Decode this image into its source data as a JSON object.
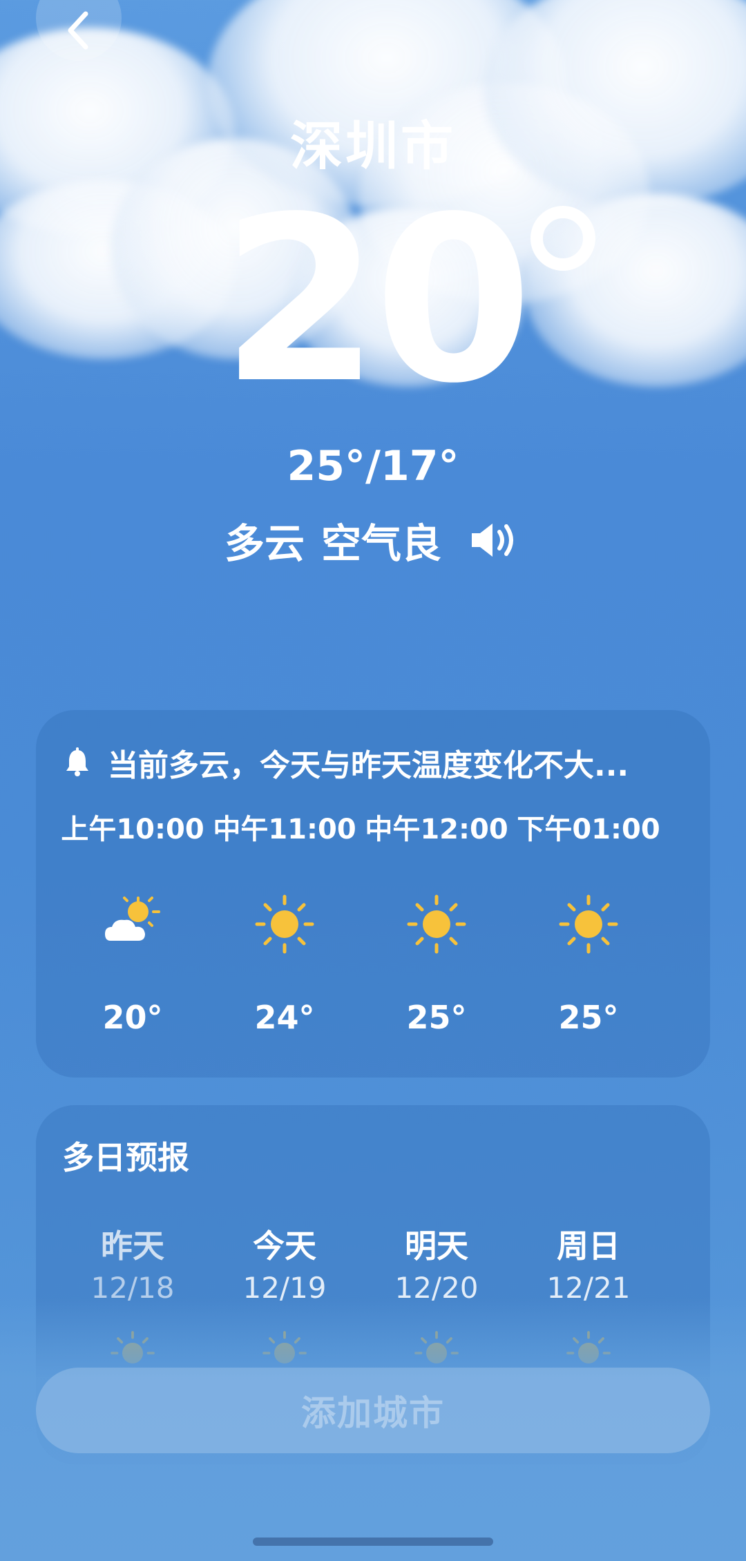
{
  "city": "深圳市",
  "current_temp": "20",
  "hi_lo": "25°/17°",
  "condition": "多云",
  "air_quality": "空气良",
  "alert": "当前多云，今天与昨天温度变化不大...",
  "hourly": [
    {
      "time": "上午10:00",
      "temp": "20°",
      "icon": "partly-cloudy-icon"
    },
    {
      "time": "中午11:00",
      "temp": "24°",
      "icon": "sunny-icon"
    },
    {
      "time": "中午12:00",
      "temp": "25°",
      "icon": "sunny-icon"
    },
    {
      "time": "下午01:00",
      "temp": "25°",
      "icon": "sunny-icon"
    }
  ],
  "daily_title": "多日预报",
  "daily": [
    {
      "day": "昨天",
      "date": "12/18",
      "icon": "sunny-icon"
    },
    {
      "day": "今天",
      "date": "12/19",
      "icon": "sunny-icon"
    },
    {
      "day": "明天",
      "date": "12/20",
      "icon": "sunny-icon"
    },
    {
      "day": "周日",
      "date": "12/21",
      "icon": "sunny-icon"
    }
  ],
  "add_city_label": "添加城市",
  "colors": {
    "background": "#4a8bd6",
    "sun": "#f7c23b",
    "text": "#ffffff"
  }
}
